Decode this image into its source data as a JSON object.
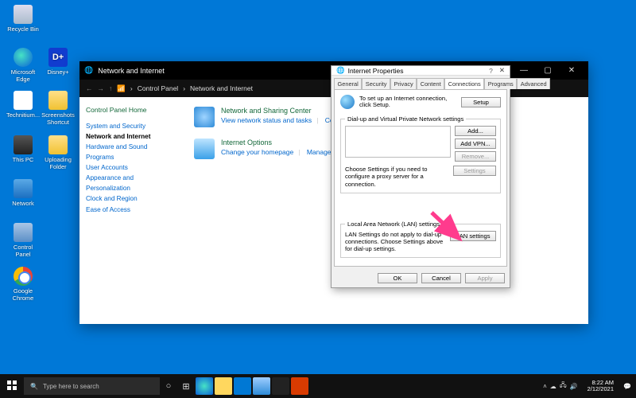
{
  "desktop": {
    "icons": [
      {
        "name": "recycle-bin",
        "label": "Recycle Bin"
      },
      {
        "name": "edge",
        "label": "Microsoft Edge"
      },
      {
        "name": "disney",
        "label": "Disney+"
      },
      {
        "name": "technitium",
        "label": "Technitium..."
      },
      {
        "name": "screenshots",
        "label": "Screenshots Shortcut"
      },
      {
        "name": "this-pc",
        "label": "This PC"
      },
      {
        "name": "uploading",
        "label": "Uploading Folder"
      },
      {
        "name": "network",
        "label": "Network"
      },
      {
        "name": "control-panel",
        "label": "Control Panel"
      },
      {
        "name": "chrome",
        "label": "Google Chrome"
      }
    ]
  },
  "cp": {
    "window_title": "Network and Internet",
    "breadcrumb": [
      "Control Panel",
      "Network and Internet"
    ],
    "sidebar": {
      "home": "Control Panel Home",
      "items": [
        "System and Security",
        "Network and Internet",
        "Hardware and Sound",
        "Programs",
        "User Accounts",
        "Appearance and Personalization",
        "Clock and Region",
        "Ease of Access"
      ],
      "selected": 1
    },
    "sections": [
      {
        "title": "Network and Sharing Center",
        "links": [
          "View network status and tasks",
          "Connect to a network"
        ]
      },
      {
        "title": "Internet Options",
        "links": [
          "Change your homepage",
          "Manage browser add-ons"
        ]
      }
    ]
  },
  "ip": {
    "title": "Internet Properties",
    "tabs": [
      "General",
      "Security",
      "Privacy",
      "Content",
      "Connections",
      "Programs",
      "Advanced"
    ],
    "active_tab": 4,
    "setup_text": "To set up an Internet connection, click Setup.",
    "setup_btn": "Setup",
    "dialup_legend": "Dial-up and Virtual Private Network settings",
    "buttons": {
      "add": "Add...",
      "addvpn": "Add VPN...",
      "remove": "Remove...",
      "settings": "Settings"
    },
    "proxy_text": "Choose Settings if you need to configure a proxy server for a connection.",
    "lan_legend": "Local Area Network (LAN) settings",
    "lan_text": "LAN Settings do not apply to dial-up connections. Choose Settings above for dial-up settings.",
    "lan_btn": "LAN settings",
    "ok": "OK",
    "cancel": "Cancel",
    "apply": "Apply"
  },
  "taskbar": {
    "search_placeholder": "Type here to search",
    "time": "8:22 AM",
    "date": "2/12/2021"
  }
}
